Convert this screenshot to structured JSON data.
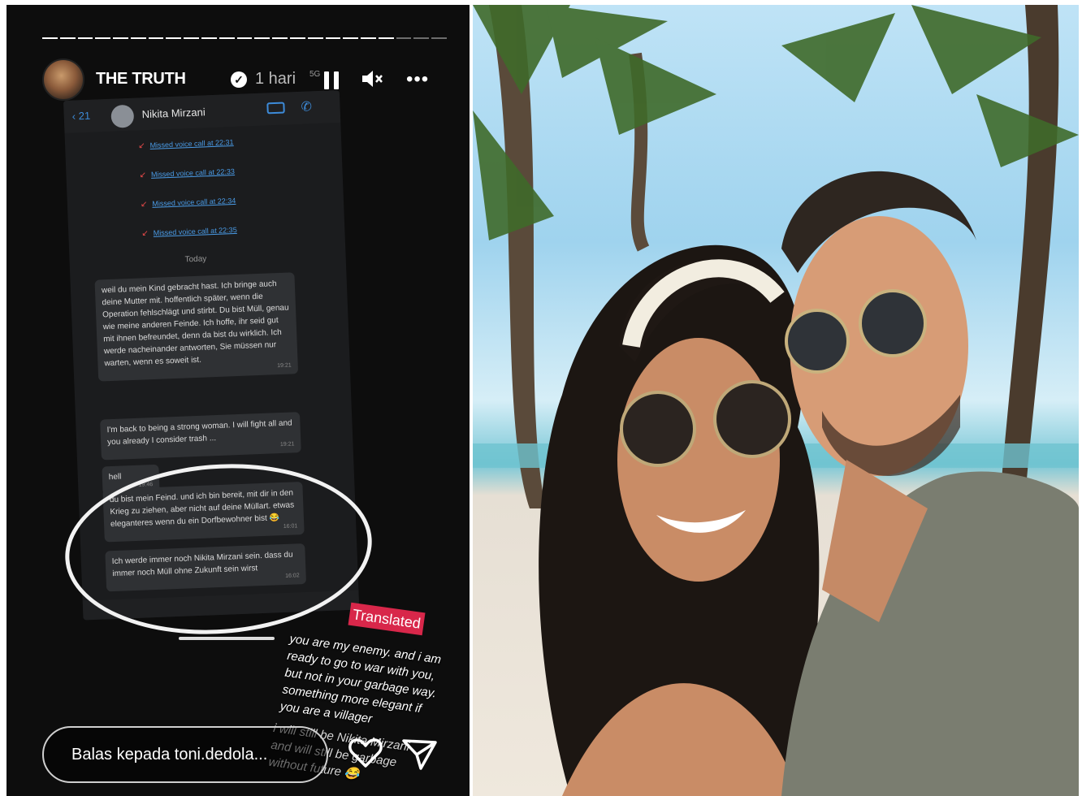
{
  "story": {
    "username": "THE TRUTH",
    "time": "1 hari",
    "network": "5G",
    "pause_label": "pause",
    "mute_label": "mute",
    "more_label": "•••",
    "reply_placeholder": "Balas kepada toni.dedola...",
    "icons": [
      "verified-icon",
      "pause-icon",
      "mute-icon",
      "more-icon",
      "heart-icon",
      "send-icon"
    ]
  },
  "screenshot": {
    "back_count": "21",
    "contact_name": "Nikita Mirzani",
    "missed_calls": [
      "Missed voice call at 22:31",
      "Missed voice call at 22:33",
      "Missed voice call at 22:34",
      "Missed voice call at 22:35"
    ],
    "date_label": "Today",
    "messages": [
      {
        "text": "weil du mein Kind gebracht hast. Ich bringe auch deine Mutter mit. hoffentlich später, wenn die Operation fehlschlägt und stirbt. Du bist Müll, genau wie meine anderen Feinde. Ich hoffe, ihr seid gut mit ihnen befreundet, denn da bist du wirklich. Ich werde nacheinander antworten, Sie müssen nur warten, wenn es soweit ist.",
        "time": "19:21"
      },
      {
        "text": "I'm back to being a strong woman. I will fight all and you already I consider trash ...",
        "time": "19:21"
      },
      {
        "text": "hell",
        "time": "19:46"
      },
      {
        "text": "du bist mein Feind. und ich bin bereit, mit dir in den Krieg zu ziehen, aber nicht auf deine Müllart. etwas eleganteres wenn du ein Dorfbewohner bist 😂",
        "time": "16:01"
      },
      {
        "text": "Ich werde immer noch Nikita Mirzani sein. dass du immer noch Müll ohne Zukunft sein wirst",
        "time": "16:02"
      }
    ]
  },
  "overlay": {
    "tag": "Translated",
    "translation_1": "you are my enemy. and i am ready to go to war with you, but not in your garbage way. something more elegant if you are a villager",
    "translation_2": "i will still be Nikita Mirzani and will still be garbage without future 😂"
  },
  "colors": {
    "story_bg": "#0d0d0d",
    "link_blue": "#3d8bd9",
    "missed_red": "#e04848",
    "tag_red": "#d8274a"
  }
}
